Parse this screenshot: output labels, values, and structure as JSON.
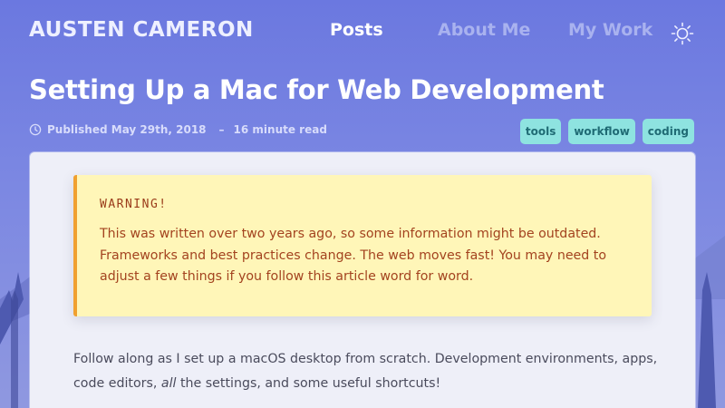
{
  "header": {
    "brand": "AUSTEN CAMERON",
    "nav": [
      {
        "label": "Posts",
        "active": true
      },
      {
        "label": "About Me",
        "active": false
      },
      {
        "label": "My Work",
        "active": false
      }
    ],
    "theme_toggle_icon": "sun-icon"
  },
  "article": {
    "title": "Setting Up a Mac for Web Development",
    "published": "Published May 29th, 2018",
    "separator": "–",
    "read_time": "16 minute read",
    "tags": [
      "tools",
      "workflow",
      "coding"
    ],
    "warning": {
      "label": "WARNING!",
      "text": "This was written over two years ago, so some information might be outdated. Frameworks and best practices change. The web moves fast! You may need to adjust a few things if you follow this article word for word."
    },
    "intro": {
      "before": "Follow along as I set up a macOS desktop from scratch. Development environments, apps, code editors, ",
      "emphasis": "all",
      "after": " the settings, and some useful shortcuts!"
    }
  },
  "colors": {
    "background_top": "#6b78e0",
    "tag_background": "#8ee3e0",
    "warning_background": "#fff6b8",
    "warning_border": "#f0a030",
    "warning_text": "#a3431f"
  }
}
